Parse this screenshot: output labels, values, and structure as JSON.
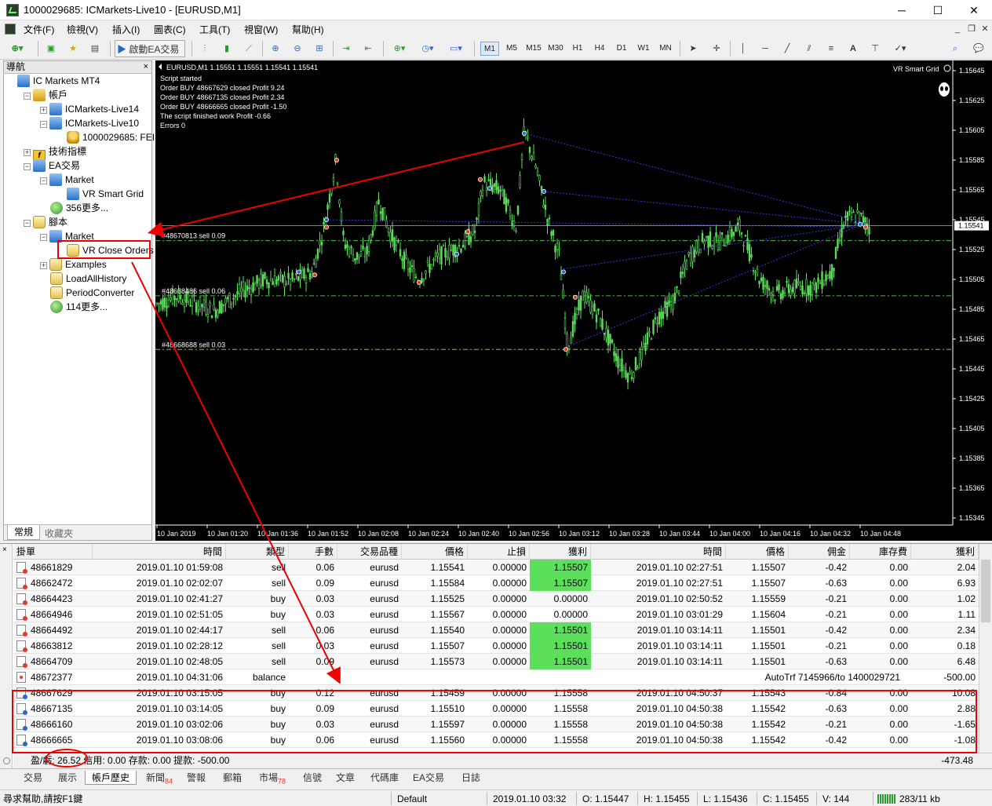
{
  "window": {
    "title": "1000029685: ICMarkets-Live10 - [EURUSD,M1]",
    "min": "─",
    "max": "☐",
    "close": "✕"
  },
  "menu": [
    "文件(F)",
    "檢視(V)",
    "插入(I)",
    "圖表(C)",
    "工具(T)",
    "視窗(W)",
    "幫助(H)"
  ],
  "toolbar": {
    "auto_trading": "啟動EA交易",
    "timeframes": [
      "M1",
      "M5",
      "M15",
      "M30",
      "H1",
      "H4",
      "D1",
      "W1",
      "MN"
    ]
  },
  "navigator": {
    "title": "導航",
    "close": "×",
    "tree": [
      {
        "label": "IC Markets MT4",
        "icon": "terminal-icon",
        "depth": 0
      },
      {
        "label": "帳戶",
        "icon": "accounts-icon",
        "depth": 1,
        "exp": "−"
      },
      {
        "label": "ICMarkets-Live14",
        "icon": "server-icon",
        "depth": 2,
        "exp": "+"
      },
      {
        "label": "ICMarkets-Live10",
        "icon": "server-icon",
        "depth": 2,
        "exp": "−"
      },
      {
        "label": "1000029685: FEI`",
        "icon": "user-icon",
        "depth": 3
      },
      {
        "label": "技術指標",
        "icon": "indicators-icon",
        "depth": 1,
        "exp": "+"
      },
      {
        "label": "EA交易",
        "icon": "expert-advisors-icon",
        "depth": 1,
        "exp": "−"
      },
      {
        "label": "Market",
        "icon": "market-icon",
        "depth": 2,
        "exp": "−"
      },
      {
        "label": "VR Smart Grid",
        "icon": "expert-icon",
        "depth": 3
      },
      {
        "label": "356更多...",
        "icon": "globe-icon",
        "depth": 2
      },
      {
        "label": "腳本",
        "icon": "scripts-icon",
        "depth": 1,
        "exp": "−"
      },
      {
        "label": "Market",
        "icon": "market-icon",
        "depth": 2,
        "exp": "−"
      },
      {
        "label": "VR Close Orders",
        "icon": "script-icon",
        "depth": 3
      },
      {
        "label": "Examples",
        "icon": "folder-icon",
        "depth": 2,
        "exp": "+"
      },
      {
        "label": "LoadAllHistory",
        "icon": "script-icon",
        "depth": 2
      },
      {
        "label": "PeriodConverter",
        "icon": "script-icon",
        "depth": 2
      },
      {
        "label": "114更多...",
        "icon": "globe-icon",
        "depth": 2
      }
    ],
    "tabs": [
      "常規",
      "收藏夾"
    ]
  },
  "chart": {
    "header": "EURUSD,M1  1.15551 1.15551 1.15541 1.15541",
    "ea_name": "VR Smart Grid",
    "log": [
      "Script started",
      "Order BUY 48667629 closed Profit 9.24",
      "Order BUY 48667135 closed Profit 2.34",
      "Order BUY 48666665 closed Profit -1.50",
      "The script finished work Profit -0.66",
      "Errors 0"
    ],
    "price_labels": [
      "1.15645",
      "1.15625",
      "1.15605",
      "1.15585",
      "1.15565",
      "1.15545",
      "1.15525",
      "1.15505",
      "1.15485",
      "1.15465",
      "1.15445",
      "1.15425",
      "1.15405",
      "1.15385",
      "1.15365",
      "1.15345"
    ],
    "current_price": "1.15541",
    "time_labels": [
      "10 Jan 2019",
      "10 Jan 01:20",
      "10 Jan 01:36",
      "10 Jan 01:52",
      "10 Jan 02:08",
      "10 Jan 02:24",
      "10 Jan 02:40",
      "10 Jan 02:56",
      "10 Jan 03:12",
      "10 Jan 03:28",
      "10 Jan 03:44",
      "10 Jan 04:00",
      "10 Jan 04:16",
      "10 Jan 04:32",
      "10 Jan 04:48"
    ],
    "order_lines": [
      {
        "label": "#48670813 sell 0.09",
        "price": 1.15531
      },
      {
        "label": "#48668486 sell 0.06",
        "price": 1.15494
      },
      {
        "label": "#48668688 sell 0.03",
        "price": 1.15458
      }
    ],
    "colors": {
      "candle": "#5ce05c",
      "grid_line": "#3fbf3f",
      "order_line": "#d0a020",
      "trade_line": "#2a3adc",
      "up_marker": "#2a66d0",
      "down_marker": "#e03a2a"
    }
  },
  "terminal": {
    "close": "×",
    "columns": [
      "掛單",
      "時間",
      "類型",
      "手數",
      "交易品種",
      "價格",
      "止損",
      "獲利",
      "時間",
      "價格",
      "佣金",
      "庫存費",
      "獲利"
    ],
    "rows": [
      {
        "kind": "sell",
        "ticket": "48661829",
        "open_time": "2019.01.10 01:59:08",
        "type": "sell",
        "lots": "0.06",
        "symbol": "eurusd",
        "price": "1.15541",
        "sl": "0.00000",
        "tp": "1.15507",
        "close_time": "2019.01.10 02:27:51",
        "close_price": "1.15507",
        "commission": "-0.42",
        "swap": "0.00",
        "profit": "2.04",
        "tp_hit": true
      },
      {
        "kind": "sell",
        "ticket": "48662472",
        "open_time": "2019.01.10 02:02:07",
        "type": "sell",
        "lots": "0.09",
        "symbol": "eurusd",
        "price": "1.15584",
        "sl": "0.00000",
        "tp": "1.15507",
        "close_time": "2019.01.10 02:27:51",
        "close_price": "1.15507",
        "commission": "-0.63",
        "swap": "0.00",
        "profit": "6.93",
        "tp_hit": true
      },
      {
        "kind": "sell",
        "ticket": "48664423",
        "open_time": "2019.01.10 02:41:27",
        "type": "buy",
        "lots": "0.03",
        "symbol": "eurusd",
        "price": "1.15525",
        "sl": "0.00000",
        "tp": "0.00000",
        "close_time": "2019.01.10 02:50:52",
        "close_price": "1.15559",
        "commission": "-0.21",
        "swap": "0.00",
        "profit": "1.02",
        "tp_hit": false
      },
      {
        "kind": "sell",
        "ticket": "48664946",
        "open_time": "2019.01.10 02:51:05",
        "type": "buy",
        "lots": "0.03",
        "symbol": "eurusd",
        "price": "1.15567",
        "sl": "0.00000",
        "tp": "0.00000",
        "close_time": "2019.01.10 03:01:29",
        "close_price": "1.15604",
        "commission": "-0.21",
        "swap": "0.00",
        "profit": "1.11",
        "tp_hit": false
      },
      {
        "kind": "sell",
        "ticket": "48664492",
        "open_time": "2019.01.10 02:44:17",
        "type": "sell",
        "lots": "0.06",
        "symbol": "eurusd",
        "price": "1.15540",
        "sl": "0.00000",
        "tp": "1.15501",
        "close_time": "2019.01.10 03:14:11",
        "close_price": "1.15501",
        "commission": "-0.42",
        "swap": "0.00",
        "profit": "2.34",
        "tp_hit": true
      },
      {
        "kind": "sell",
        "ticket": "48663812",
        "open_time": "2019.01.10 02:28:12",
        "type": "sell",
        "lots": "0.03",
        "symbol": "eurusd",
        "price": "1.15507",
        "sl": "0.00000",
        "tp": "1.15501",
        "close_time": "2019.01.10 03:14:11",
        "close_price": "1.15501",
        "commission": "-0.21",
        "swap": "0.00",
        "profit": "0.18",
        "tp_hit": true
      },
      {
        "kind": "sell",
        "ticket": "48664709",
        "open_time": "2019.01.10 02:48:05",
        "type": "sell",
        "lots": "0.09",
        "symbol": "eurusd",
        "price": "1.15573",
        "sl": "0.00000",
        "tp": "1.15501",
        "close_time": "2019.01.10 03:14:11",
        "close_price": "1.15501",
        "commission": "-0.63",
        "swap": "0.00",
        "profit": "6.48",
        "tp_hit": true
      },
      {
        "kind": "bal",
        "ticket": "48672377",
        "open_time": "2019.01.10 04:31:06",
        "type": "balance",
        "lots": "",
        "symbol": "",
        "price": "",
        "sl": "",
        "tp": "",
        "close_time": "",
        "close_price": "",
        "commission": "",
        "swap": "",
        "profit": "-500.00",
        "tp_hit": false,
        "comment": "AutoTrf 7145966/to 1400029721"
      },
      {
        "kind": "buy",
        "ticket": "48667629",
        "open_time": "2019.01.10 03:15:05",
        "type": "buy",
        "lots": "0.12",
        "symbol": "eurusd",
        "price": "1.15459",
        "sl": "0.00000",
        "tp": "1.15558",
        "close_time": "2019.01.10 04:50:37",
        "close_price": "1.15543",
        "commission": "-0.84",
        "swap": "0.00",
        "profit": "10.08",
        "tp_hit": false
      },
      {
        "kind": "buy",
        "ticket": "48667135",
        "open_time": "2019.01.10 03:14:05",
        "type": "buy",
        "lots": "0.09",
        "symbol": "eurusd",
        "price": "1.15510",
        "sl": "0.00000",
        "tp": "1.15558",
        "close_time": "2019.01.10 04:50:38",
        "close_price": "1.15542",
        "commission": "-0.63",
        "swap": "0.00",
        "profit": "2.88",
        "tp_hit": false
      },
      {
        "kind": "buy",
        "ticket": "48666160",
        "open_time": "2019.01.10 03:02:06",
        "type": "buy",
        "lots": "0.03",
        "symbol": "eurusd",
        "price": "1.15597",
        "sl": "0.00000",
        "tp": "1.15558",
        "close_time": "2019.01.10 04:50:38",
        "close_price": "1.15542",
        "commission": "-0.21",
        "swap": "0.00",
        "profit": "-1.65",
        "tp_hit": false
      },
      {
        "kind": "buy",
        "ticket": "48666665",
        "open_time": "2019.01.10 03:08:06",
        "type": "buy",
        "lots": "0.06",
        "symbol": "eurusd",
        "price": "1.15560",
        "sl": "0.00000",
        "tp": "1.15558",
        "close_time": "2019.01.10 04:50:38",
        "close_price": "1.15542",
        "commission": "-0.42",
        "swap": "0.00",
        "profit": "-1.08",
        "tp_hit": false
      }
    ],
    "summary": "盈/虧: 26.52  信用: 0.00  存款: 0.00  提款: -500.00",
    "summary_total": "-473.48",
    "tabs": [
      {
        "label": "交易"
      },
      {
        "label": "展示"
      },
      {
        "label": "帳戶歷史",
        "active": true
      },
      {
        "label": "新聞",
        "badge": "84"
      },
      {
        "label": "警報"
      },
      {
        "label": "郵箱"
      },
      {
        "label": "市場",
        "badge": "78"
      },
      {
        "label": "信號"
      },
      {
        "label": "文章"
      },
      {
        "label": "代碼庫"
      },
      {
        "label": "EA交易"
      },
      {
        "label": "日誌"
      }
    ]
  },
  "statusbar": {
    "help": "尋求幫助,請按F1鍵",
    "profile": "Default",
    "datetime": "2019.01.10 03:32",
    "open": "O: 1.15447",
    "high": "H: 1.15455",
    "low": "L: 1.15436",
    "close": "C: 1.15455",
    "volume": "V: 144",
    "traffic": "283/11 kb"
  }
}
